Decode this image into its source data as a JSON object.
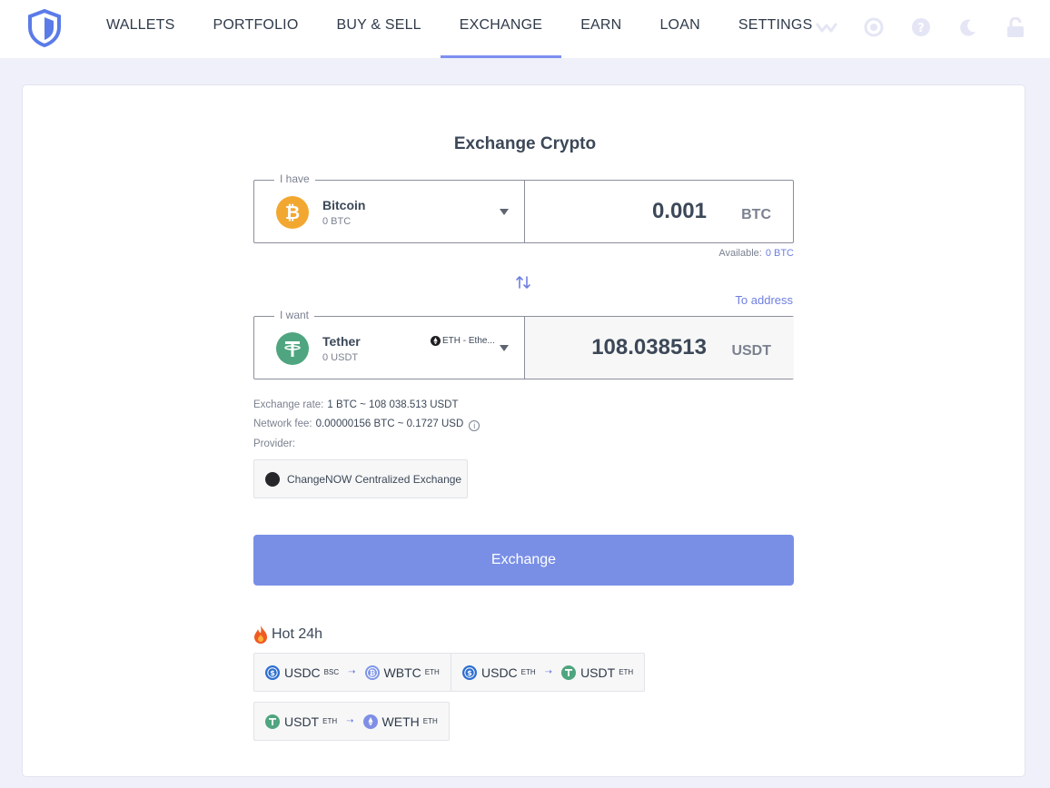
{
  "nav": {
    "items": [
      {
        "label": "WALLETS",
        "active": false
      },
      {
        "label": "PORTFOLIO",
        "active": false
      },
      {
        "label": "BUY & SELL",
        "active": false
      },
      {
        "label": "EXCHANGE",
        "active": true
      },
      {
        "label": "EARN",
        "active": false
      },
      {
        "label": "LOAN",
        "active": false
      },
      {
        "label": "SETTINGS",
        "active": false
      }
    ],
    "tools": [
      "walletconnect-icon",
      "sync-icon",
      "help-icon",
      "dark-mode-icon",
      "lock-icon"
    ]
  },
  "title": "Exchange Crypto",
  "from": {
    "legend": "I have",
    "name": "Bitcoin",
    "balance": "0 BTC",
    "amount": "0.001",
    "unit": "BTC",
    "icon": "bitcoin-icon"
  },
  "available": {
    "label": "Available:",
    "value": "0 BTC"
  },
  "to_address": "To address",
  "to": {
    "legend": "I want",
    "name": "Tether",
    "balance": "0 USDT",
    "network": "ETH - Ethe...",
    "amount": "108.038513",
    "unit": "USDT",
    "icon": "tether-icon"
  },
  "info": {
    "rate_label": "Exchange rate:",
    "rate_value": "1 BTC ~ 108 038.513 USDT",
    "fee_label": "Network fee:",
    "fee_value": "0.00000156 BTC ~ 0.1727 USD",
    "provider_label": "Provider:"
  },
  "provider": "ChangeNOW Centralized Exchange",
  "exchange_button": "Exchange",
  "hot": {
    "title": "Hot 24h",
    "pairs": [
      {
        "from": "USDC",
        "from_net": "BSC",
        "to": "WBTC",
        "to_net": "ETH"
      },
      {
        "from": "USDC",
        "from_net": "ETH",
        "to": "USDT",
        "to_net": "ETH"
      },
      {
        "from": "USDT",
        "from_net": "ETH",
        "to": "WETH",
        "to_net": "ETH"
      }
    ]
  },
  "colors": {
    "accent": "#798fe6",
    "bitcoin": "#f2a830",
    "tether": "#4fa57f",
    "usdc": "#2e6fd0"
  }
}
